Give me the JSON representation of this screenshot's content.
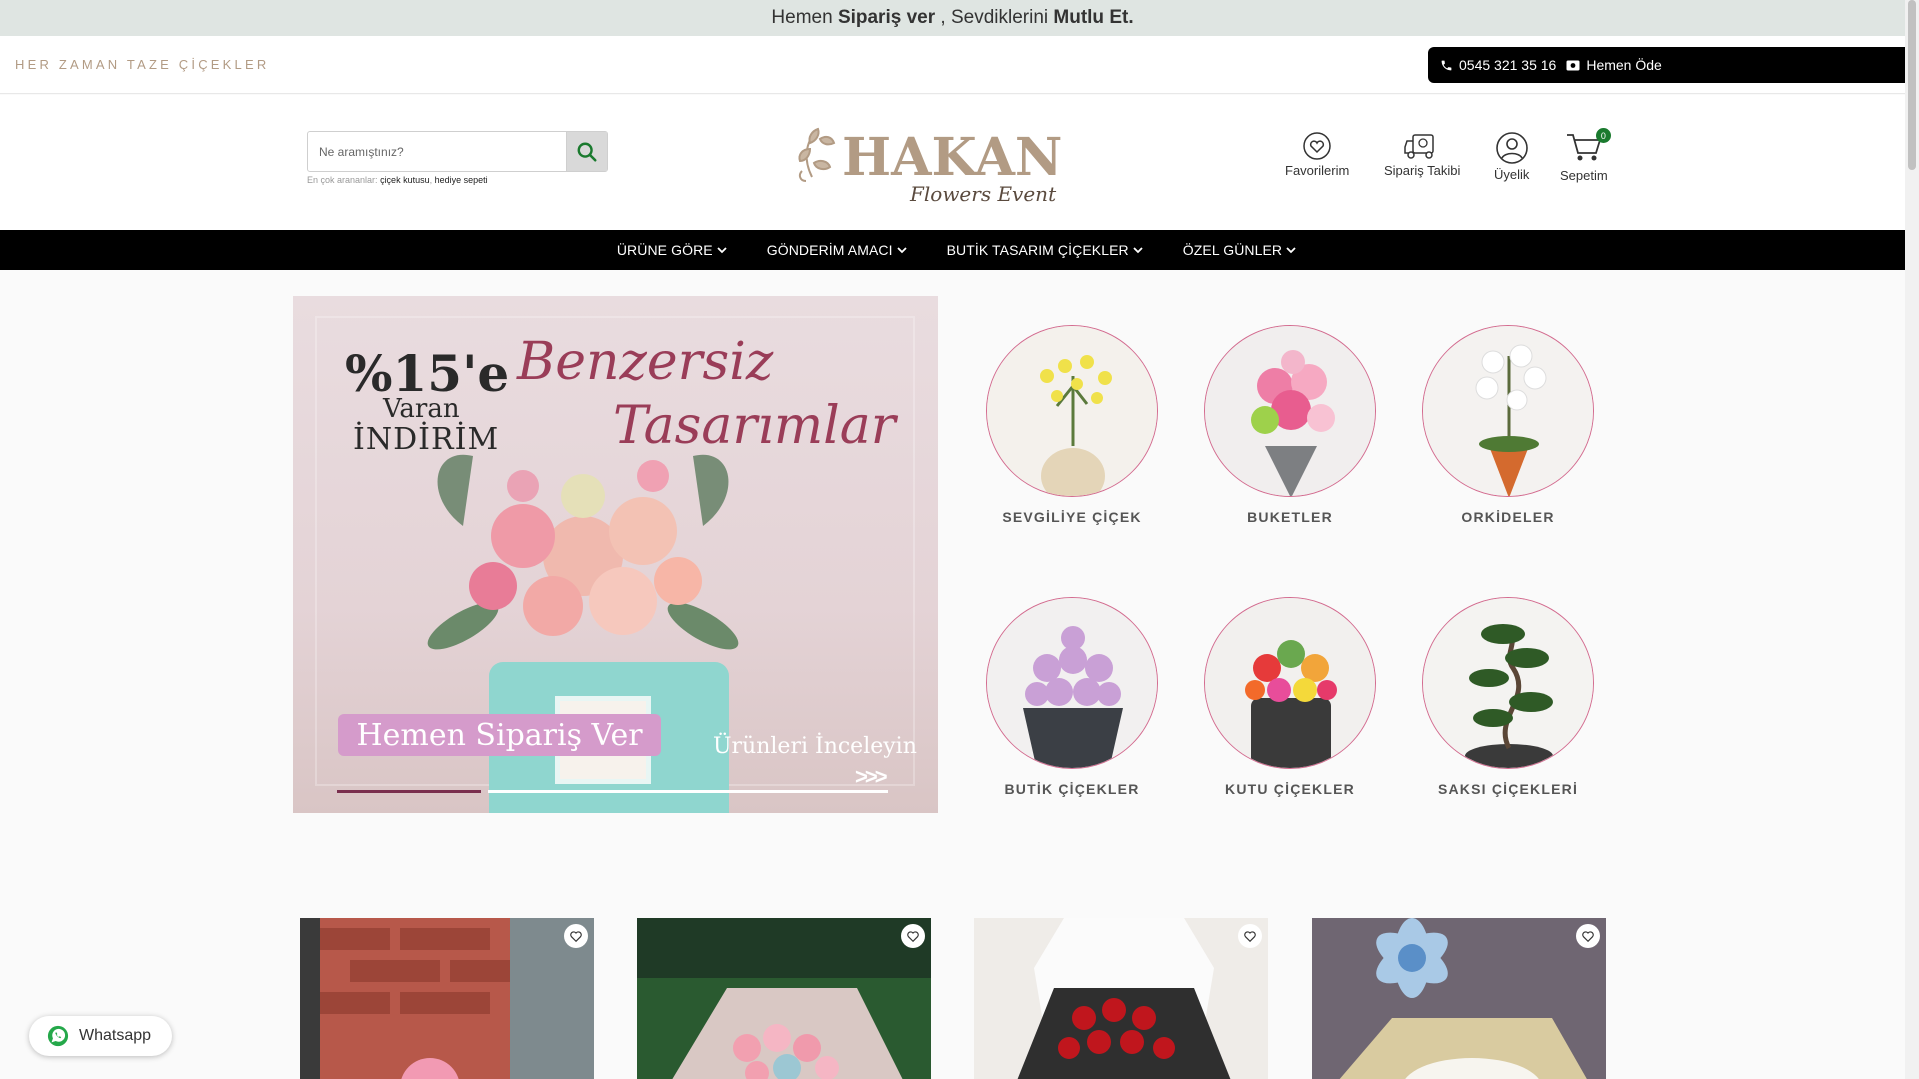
{
  "announcement": {
    "prefix": "Hemen",
    "bold1": "Sipariş ver",
    "middle": ", Sevdiklerini",
    "bold2": "Mutlu Et."
  },
  "utility": {
    "tagline": "HER ZAMAN TAZE ÇİÇEKLER",
    "phone": "0545 321 35 16",
    "pay_label": "Hemen Öde"
  },
  "search": {
    "placeholder": "Ne aramıştınız?",
    "popular_label": "En çok arananlar:",
    "popular_terms": [
      "çiçek kutusu",
      "hediye sepeti"
    ]
  },
  "brand": {
    "name": "HAKAN",
    "sub": "Flowers Event"
  },
  "header_icons": [
    {
      "label": "Favorilerim",
      "icon": "heart-icon"
    },
    {
      "label": "Sipariş Takibi",
      "icon": "truck-icon"
    },
    {
      "label": "Üyelik",
      "icon": "user-icon"
    },
    {
      "label": "Sepetim",
      "icon": "cart-icon",
      "count": "0"
    }
  ],
  "nav": [
    {
      "label": "ÜRÜNE GÖRE"
    },
    {
      "label": "GÖNDERİM AMACI"
    },
    {
      "label": "BUTİK TASARIM ÇİÇEKLER"
    },
    {
      "label": "ÖZEL GÜNLER"
    }
  ],
  "hero": {
    "discount": "%15'e",
    "discount_sub": "Varan",
    "discount_word": "İNDİRİM",
    "script1": "Benzersiz",
    "script2": "Tasarımlar",
    "cta": "Hemen Sipariş Ver",
    "review": "Ürünleri İnceleyin",
    "arrows": ">>>"
  },
  "categories": [
    {
      "label": "SEVGİLİYE ÇİÇEK"
    },
    {
      "label": "BUKETLER"
    },
    {
      "label": "ORKİDELER"
    },
    {
      "label": "BUTİK ÇİÇEKLER"
    },
    {
      "label": "KUTU ÇİÇEKLER"
    },
    {
      "label": "SAKSI ÇİÇEKLERİ"
    }
  ],
  "whatsapp": {
    "label": "Whatsapp"
  },
  "colors": {
    "accent": "#9a3d58",
    "nav_bg": "#000000",
    "announce_bg": "#dfe5e2",
    "badge": "#1a7a2e",
    "circle_border": "#d36b8f"
  }
}
